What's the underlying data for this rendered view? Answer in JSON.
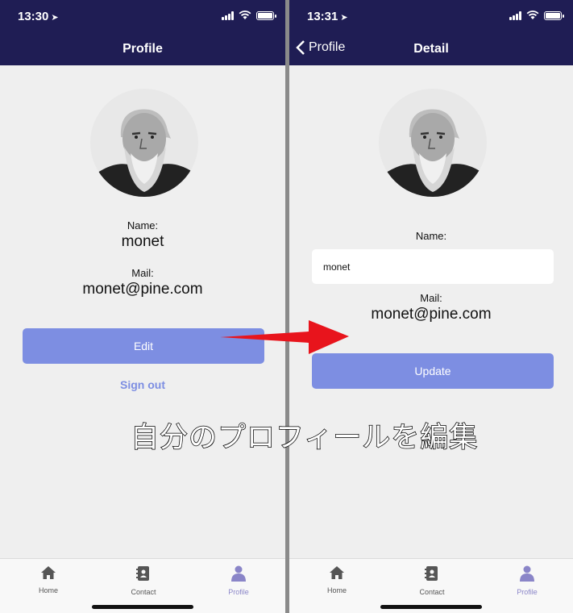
{
  "left": {
    "status": {
      "time": "13:30",
      "location_icon": "location-arrow-icon"
    },
    "title": "Profile",
    "name_label": "Name:",
    "name_value": "monet",
    "mail_label": "Mail:",
    "mail_value": "monet@pine.com",
    "edit_button": "Edit",
    "signout_link": "Sign out"
  },
  "right": {
    "status": {
      "time": "13:31",
      "location_icon": "location-arrow-icon"
    },
    "back_label": "Profile",
    "title": "Detail",
    "name_label": "Name:",
    "name_input_value": "monet",
    "mail_label": "Mail:",
    "mail_value": "monet@pine.com",
    "update_button": "Update"
  },
  "tabs": [
    {
      "label": "Home",
      "icon": "home-icon"
    },
    {
      "label": "Contact",
      "icon": "contact-book-icon"
    },
    {
      "label": "Profile",
      "icon": "person-icon",
      "active": true
    }
  ],
  "overlay_caption": "自分のプロフィールを編集",
  "colors": {
    "header": "#1f1d54",
    "accent": "#7d8ee2",
    "background": "#efefef",
    "arrow": "#e8141c"
  }
}
